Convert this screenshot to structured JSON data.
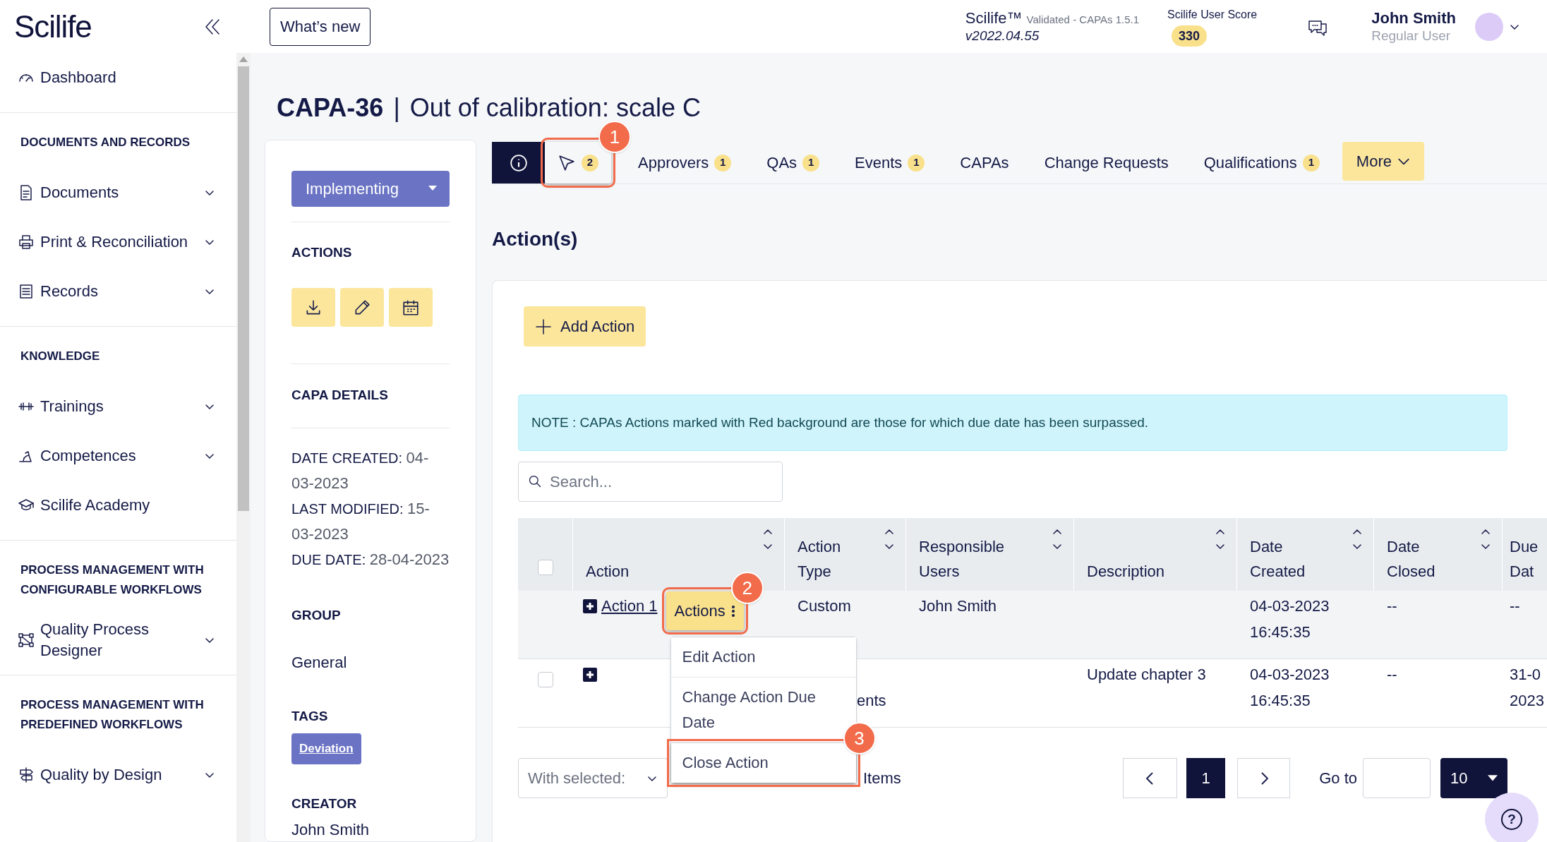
{
  "top_bar": {
    "logo": "Scilife",
    "whats_new_button": "What’s new",
    "product": {
      "name": "Scilife™",
      "status": "Validated - CAPAs 1.5.1",
      "version": "v2022.04.55"
    },
    "score": {
      "label": "Scilife User Score",
      "value": "330"
    },
    "user": {
      "name": "John Smith",
      "role": "Regular User"
    }
  },
  "sidebar": {
    "sections": [
      {
        "items": [
          {
            "label": "Dashboard",
            "expandable": false
          }
        ]
      },
      {
        "heading": "DOCUMENTS AND RECORDS",
        "items": [
          {
            "label": "Documents",
            "expandable": true
          },
          {
            "label": "Print & Reconciliation",
            "expandable": true
          },
          {
            "label": "Records",
            "expandable": true
          }
        ]
      },
      {
        "heading": "KNOWLEDGE",
        "items": [
          {
            "label": "Trainings",
            "expandable": true
          },
          {
            "label": "Competences",
            "expandable": true
          },
          {
            "label": "Scilife Academy",
            "expandable": false
          }
        ]
      },
      {
        "heading": "PROCESS MANAGEMENT WITH CONFIGURABLE WORKFLOWS",
        "items": [
          {
            "label": "Quality Process Designer",
            "expandable": true
          }
        ]
      },
      {
        "heading": "PROCESS MANAGEMENT WITH PREDEFINED WORKFLOWS",
        "items": [
          {
            "label": "Quality by Design",
            "expandable": true
          }
        ]
      }
    ]
  },
  "title": {
    "id": "CAPA-36",
    "separator": "|",
    "name": "Out of calibration: scale C"
  },
  "details_panel": {
    "status_button": "Implementing",
    "actions_heading": "ACTIONS",
    "details_heading": "CAPA DETAILS",
    "fields": [
      {
        "label": "DATE CREATED:",
        "value": "04-03-2023"
      },
      {
        "label": "LAST MODIFIED:",
        "value": "15-03-2023"
      },
      {
        "label": "DUE DATE:",
        "value": "28-04-2023"
      }
    ],
    "group_heading": "GROUP",
    "group": "General",
    "tags_heading": "TAGS",
    "tags": [
      "Deviation"
    ],
    "creator_heading": "CREATOR",
    "creator": "John Smith"
  },
  "tabs": [
    {
      "kind": "info",
      "selected": true
    },
    {
      "kind": "pointer",
      "count": "2",
      "selected": false,
      "callout": "1"
    },
    {
      "kind": "text",
      "label": "Approvers",
      "count": "1",
      "selected": false
    },
    {
      "kind": "text",
      "label": "QAs",
      "count": "1",
      "selected": false
    },
    {
      "kind": "text",
      "label": "Events",
      "count": "1",
      "selected": false
    },
    {
      "kind": "text",
      "label": "CAPAs",
      "selected": false
    },
    {
      "kind": "text",
      "label": "Change Requests",
      "selected": false
    },
    {
      "kind": "text",
      "label": "Qualifications",
      "count": "1",
      "selected": false
    }
  ],
  "more_button": "More",
  "actions_section": {
    "heading": "Action(s)",
    "add_button": "Add Action",
    "note": "NOTE : CAPAs Actions marked with Red background are those for which due date has been surpassed.",
    "search": {
      "placeholder": "Search..."
    },
    "table": {
      "select_all": {
        "checked": false
      },
      "columns": [
        {
          "label": "Action"
        },
        {
          "label": "Action Type"
        },
        {
          "label": "Responsible Users"
        },
        {
          "label": "Description"
        },
        {
          "label": "Date Created"
        },
        {
          "label": "Date Closed"
        },
        {
          "label": "Due Dat"
        }
      ],
      "rows": [
        {
          "highlighted": true,
          "expanded": false,
          "action": "Action 1",
          "menu_button": {
            "label": "Actions",
            "callout": "2"
          },
          "action_type": "Custom",
          "responsible": "John Smith",
          "date_created": "04-03-2023 16:45:35",
          "date_closed": "--",
          "due_date": "--"
        },
        {
          "highlighted": false,
          "checked": false,
          "expanded": false,
          "action_type": "ents",
          "description": "Update chapter 3",
          "date_created": "04-03-2023 16:45:35",
          "date_closed": "--",
          "due_date": "31-0 2023"
        }
      ]
    },
    "row_menu": [
      {
        "label": "Edit Action"
      },
      {
        "label": "Change Action Due Date"
      },
      {
        "label": "Close Action",
        "callout": "3"
      }
    ],
    "footer": {
      "bulk_select": "With selected:",
      "items_text": "Items",
      "pages": [
        {
          "label": "1",
          "selected": true
        }
      ],
      "goto_label": "Go to",
      "page_size": "10"
    }
  },
  "help_button": "?"
}
